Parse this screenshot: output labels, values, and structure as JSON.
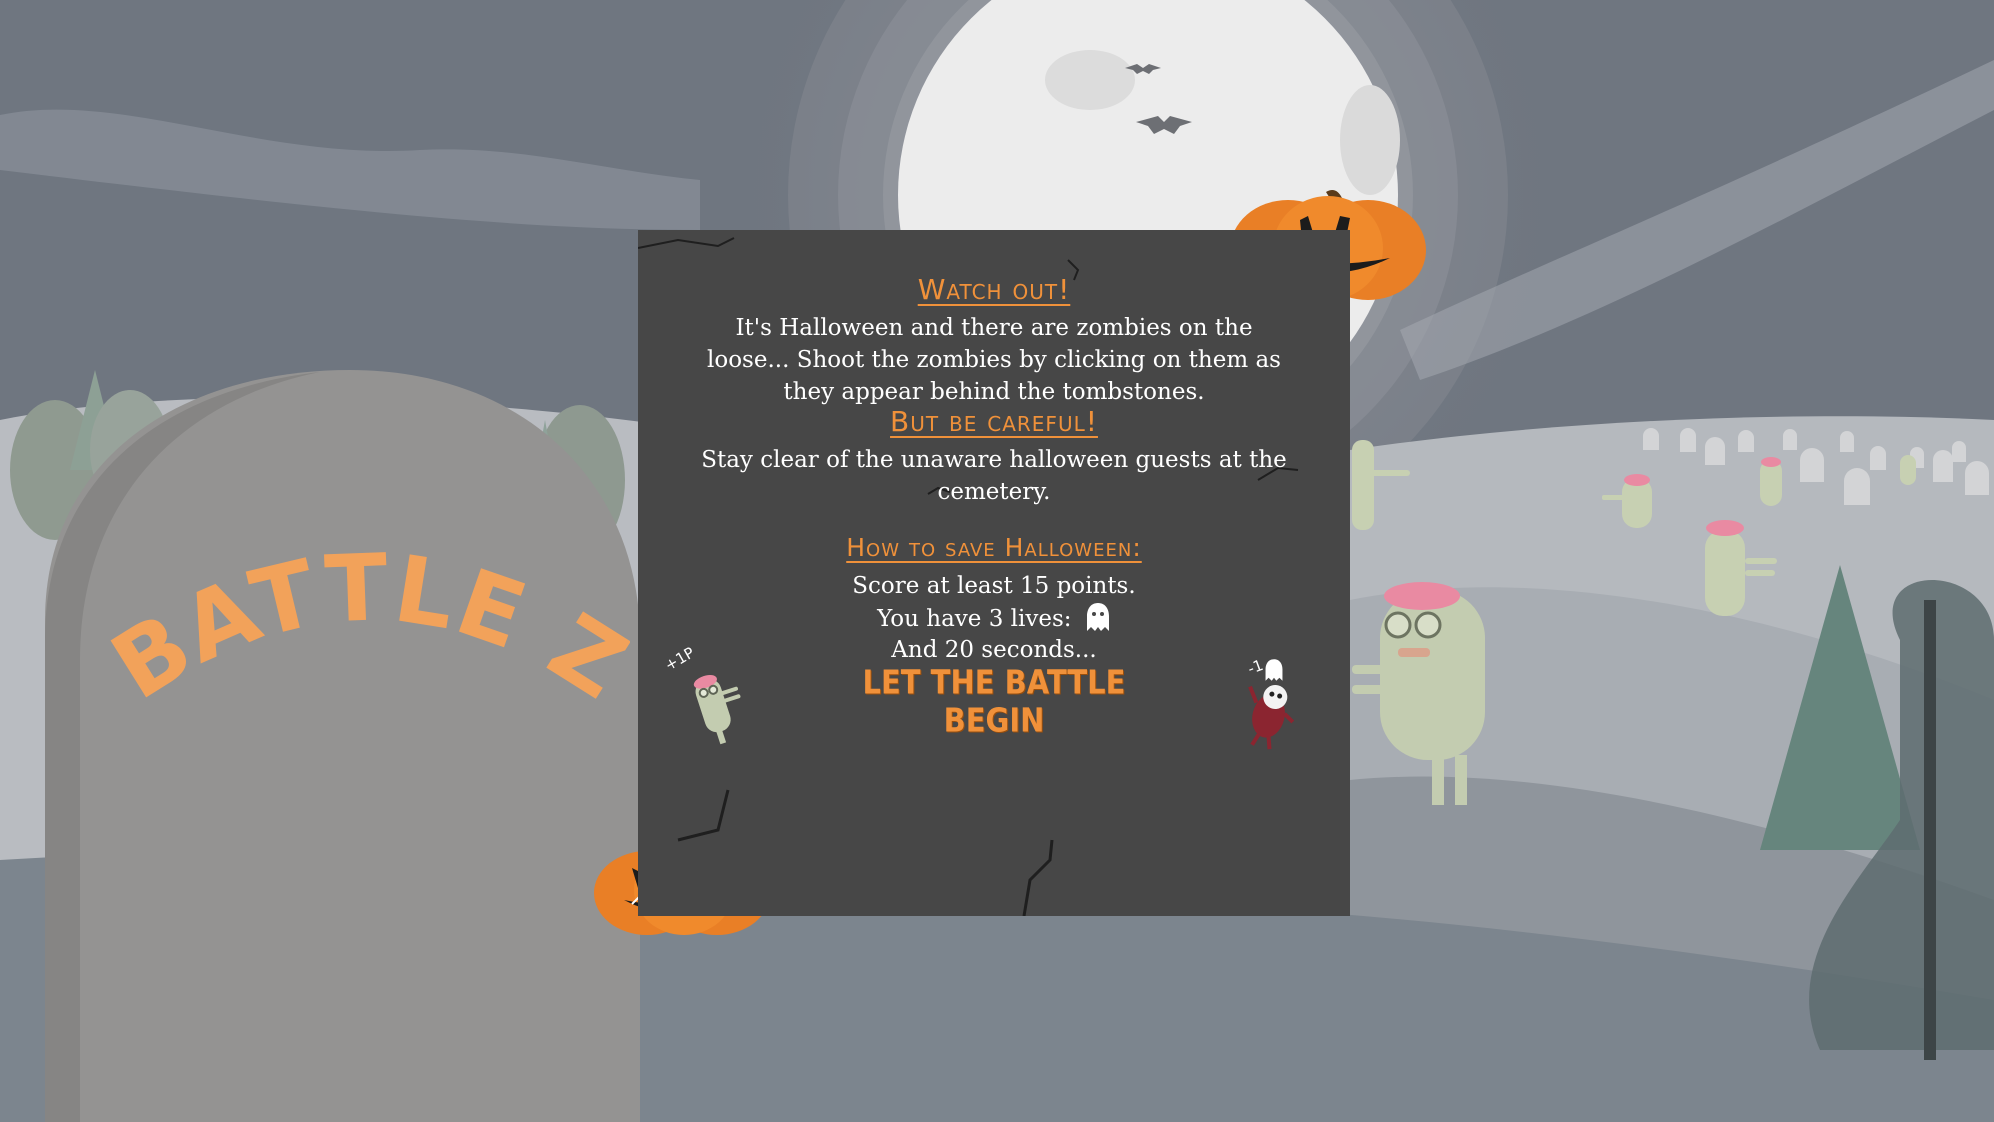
{
  "tombstone": {
    "title": "BATTLE Z"
  },
  "modal": {
    "watch_out_heading": "Watch out!",
    "intro_text": "It's Halloween and there are zombies on the loose... Shoot the zombies by clicking on them as they appear behind the tombstones.",
    "careful_heading": "But be careful!",
    "stay_clear_text": "Stay clear of the unaware halloween guests at the cemetery.",
    "how_to_heading": "How to save Halloween:",
    "score_rule": "Score at least 15 points.",
    "lives_rule": "You have 3 lives:",
    "time_rule": "And 20 seconds...",
    "start_button": "LET THE BATTLE BEGIN",
    "zombie_points": "+1P",
    "guest_penalty": "-1"
  },
  "icons": {
    "life": "ghost-icon",
    "zombie": "zombie-icon",
    "guest": "guest-icon",
    "pumpkin": "pumpkin-icon"
  },
  "colors": {
    "accent": "#f0913a",
    "modal_bg": "#474747",
    "sky": "#6f7680",
    "moon": "#ededed",
    "tombstone": "#959493",
    "zombie": "#c9d3b3",
    "brain": "#e98aa2"
  }
}
